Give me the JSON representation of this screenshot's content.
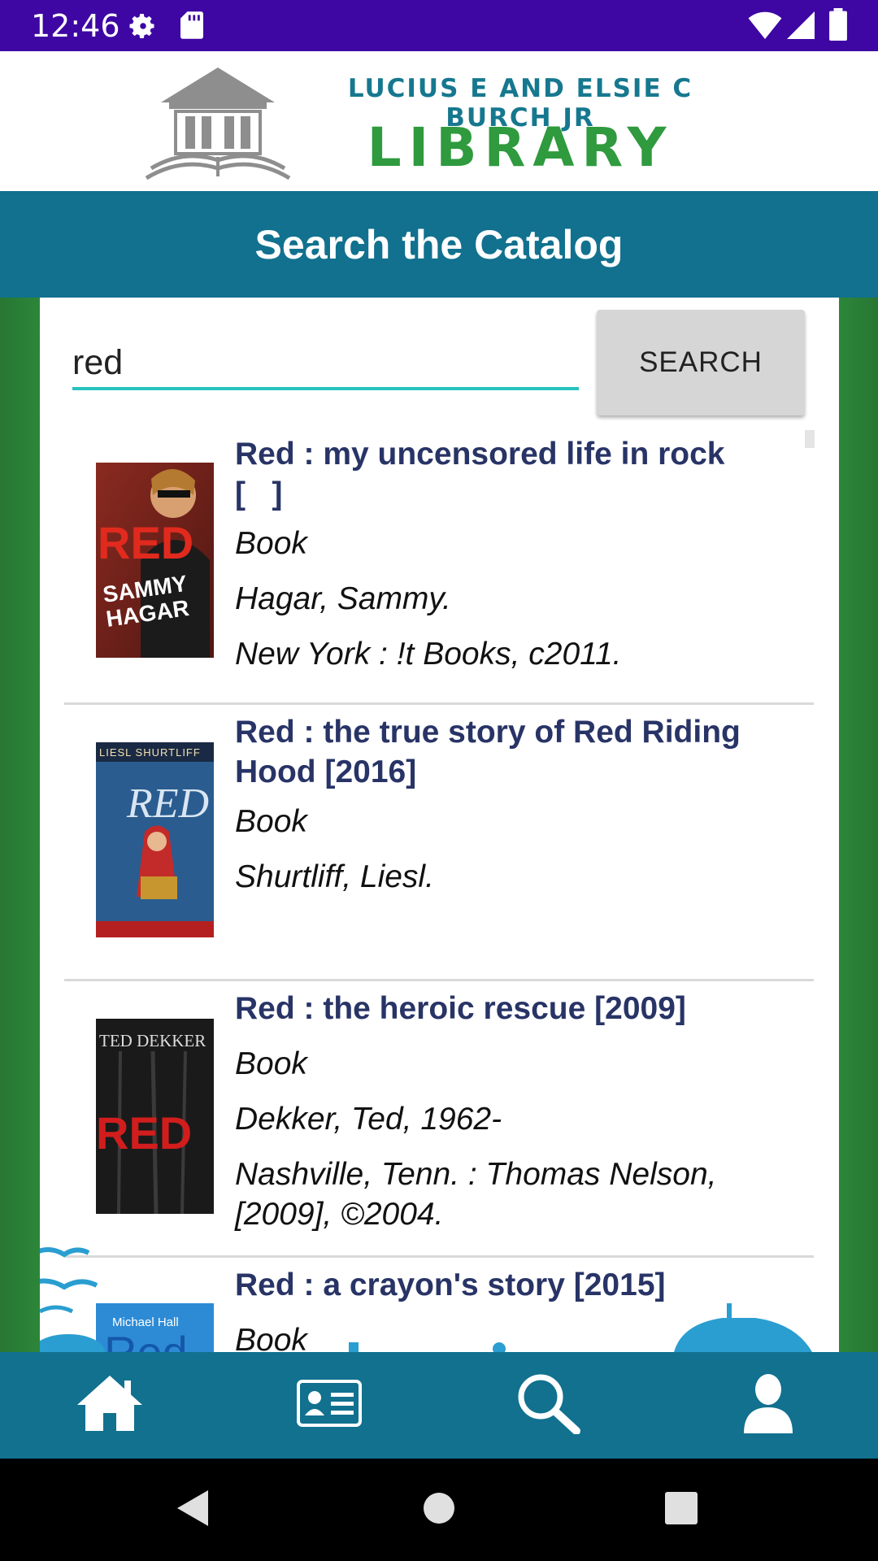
{
  "status_bar": {
    "time": "12:46",
    "icons": [
      "settings-icon",
      "sd-card-icon",
      "wifi-icon",
      "signal-icon",
      "battery-icon"
    ]
  },
  "logo": {
    "line1": "LUCIUS E AND ELSIE C BURCH JR",
    "line2": "LIBRARY"
  },
  "header": {
    "title": "Search the Catalog"
  },
  "search": {
    "query": "red",
    "button_label": "SEARCH"
  },
  "results": [
    {
      "title": "Red : my uncensored life in rock [   ]",
      "format": "Book",
      "author": "Hagar, Sammy.",
      "publisher": "New York : !t Books, c2011."
    },
    {
      "title": "Red : the true story of Red Riding Hood [2016]",
      "format": "Book",
      "author": "Shurtliff, Liesl.",
      "publisher": ""
    },
    {
      "title": "Red : the heroic rescue [2009]",
      "format": "Book",
      "author": "Dekker, Ted, 1962-",
      "publisher": "Nashville, Tenn. : Thomas Nelson, [2009], ©2004."
    },
    {
      "title": "Red : a crayon's story [2015]",
      "format": "Book",
      "author": "",
      "publisher": ""
    }
  ],
  "covers": {
    "c1": {
      "text_a": "RED",
      "text_b": "SAMMY",
      "text_c": "HAGAR"
    },
    "c2": {
      "text_a": "LIESL SHURTLIFF",
      "text_b": "RED"
    },
    "c3": {
      "text_a": "TED DEKKER",
      "text_b": "RED"
    },
    "c4": {
      "text_a": "Michael Hall",
      "text_b": "Red"
    }
  },
  "bottom_nav": [
    "home-icon",
    "library-card-icon",
    "search-icon",
    "account-icon"
  ],
  "colors": {
    "status_bar": "#3e06a3",
    "header": "#11718f",
    "side_green": "#2e8b3c",
    "title_text": "#283466",
    "input_underline": "#27c3bd"
  }
}
